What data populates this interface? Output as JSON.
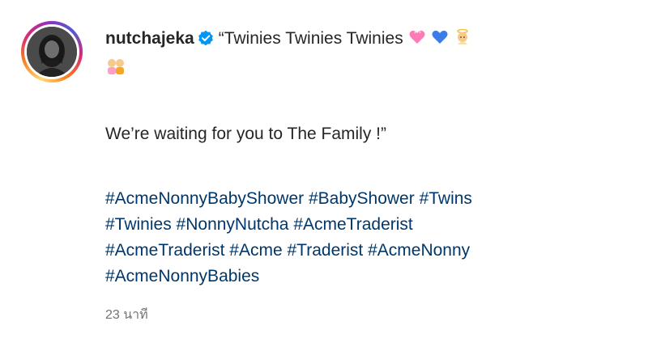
{
  "post": {
    "username": "nutchajeka",
    "verified": true,
    "caption_line1": "“Twinies Twinies Twinies",
    "caption_line2": "We’re waiting for you to The Family !”",
    "emojis": [
      "pink-heart-icon",
      "blue-heart-icon",
      "baby-angel-icon",
      "two-babies-icon"
    ],
    "hashtags_line1": [
      "#AcmeNonnyBabyShower",
      "#BabyShower",
      "#Twins"
    ],
    "hashtags_line2": [
      "#Twinies",
      "#NonnyNutcha",
      "#AcmeTraderist"
    ],
    "hashtags_line3": [
      "#AcmeTraderist",
      "#Acme",
      "#Traderist",
      "#AcmeNonny"
    ],
    "hashtags_line4": [
      "#AcmeNonnyBabies"
    ],
    "timestamp": "23 นาที"
  },
  "colors": {
    "hashtag": "#00376b",
    "verified": "#0095f6",
    "timestamp": "#737373"
  }
}
